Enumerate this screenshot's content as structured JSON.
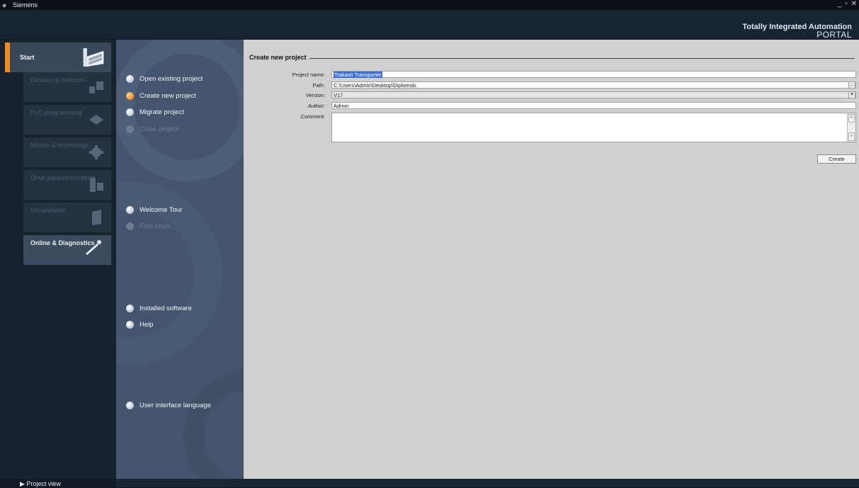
{
  "window": {
    "app_name": "Siemens",
    "controls": "_ ▫ ✕"
  },
  "brand": {
    "line1": "Totally Integrated Automation",
    "line2": "PORTAL"
  },
  "categories": [
    {
      "label": "Start",
      "state": "active",
      "icon": "factory-icon"
    },
    {
      "label": "Devices & networks",
      "state": "disabled",
      "icon": "devices-icon"
    },
    {
      "label": "PLC programming",
      "state": "disabled",
      "icon": "plc-icon"
    },
    {
      "label": "Motion & technology",
      "state": "disabled",
      "icon": "gear-icon"
    },
    {
      "label": "Drive parameterization",
      "state": "disabled",
      "icon": "drive-icon"
    },
    {
      "label": "Visualization",
      "state": "disabled",
      "icon": "panel-icon"
    },
    {
      "label": "Online & Diagnostics",
      "state": "enabled",
      "icon": "probe-icon"
    }
  ],
  "actions": [
    {
      "label": "Open existing project",
      "state": "enabled"
    },
    {
      "label": "Create new project",
      "state": "selected"
    },
    {
      "label": "Migrate project",
      "state": "enabled"
    },
    {
      "label": "Close project",
      "state": "disabled"
    },
    {
      "label": "Welcome Tour",
      "state": "enabled"
    },
    {
      "label": "First steps",
      "state": "disabled"
    },
    {
      "label": "Installed software",
      "state": "enabled"
    },
    {
      "label": "Help",
      "state": "enabled"
    },
    {
      "label": "User interface language",
      "state": "enabled"
    }
  ],
  "form": {
    "section_title": "Create new project",
    "project_name_label": "Project name:",
    "project_name_value": "Trakasti Transporter",
    "path_label": "Path:",
    "path_value": "C:\\Users\\Admin\\Desktop\\Diplomski",
    "path_browse": "...",
    "version_label": "Version:",
    "version_value": "V17",
    "author_label": "Author:",
    "author_value": "Admin",
    "comment_label": "Comment:",
    "comment_value": "",
    "create_button": "Create"
  },
  "footer": {
    "project_view": "Project view"
  },
  "colors": {
    "accent": "#f28a1c",
    "header_bg": "#172433",
    "action_panel_bg": "#44556d",
    "content_bg": "#d0d0d0"
  }
}
